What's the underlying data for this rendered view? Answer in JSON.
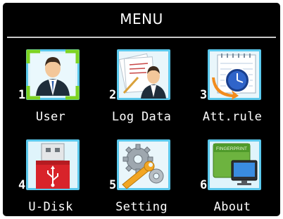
{
  "header": {
    "title": "MENU"
  },
  "items": [
    {
      "number": "1",
      "label": "User",
      "icon": "user-icon",
      "selected": true
    },
    {
      "number": "2",
      "label": "Log Data",
      "icon": "log-data-icon"
    },
    {
      "number": "3",
      "label": "Att.rule",
      "icon": "clock-calendar-icon"
    },
    {
      "number": "4",
      "label": "U-Disk",
      "icon": "usb-drive-icon"
    },
    {
      "number": "5",
      "label": "Setting",
      "icon": "gears-wrench-icon"
    },
    {
      "number": "6",
      "label": "About",
      "icon": "about-monitor-icon",
      "icon_text": "FINGERPRINT"
    }
  ],
  "colors": {
    "background": "#000000",
    "text": "#ffffff",
    "selection": "#7ed321",
    "tile_frame": "#5bc8ec"
  }
}
